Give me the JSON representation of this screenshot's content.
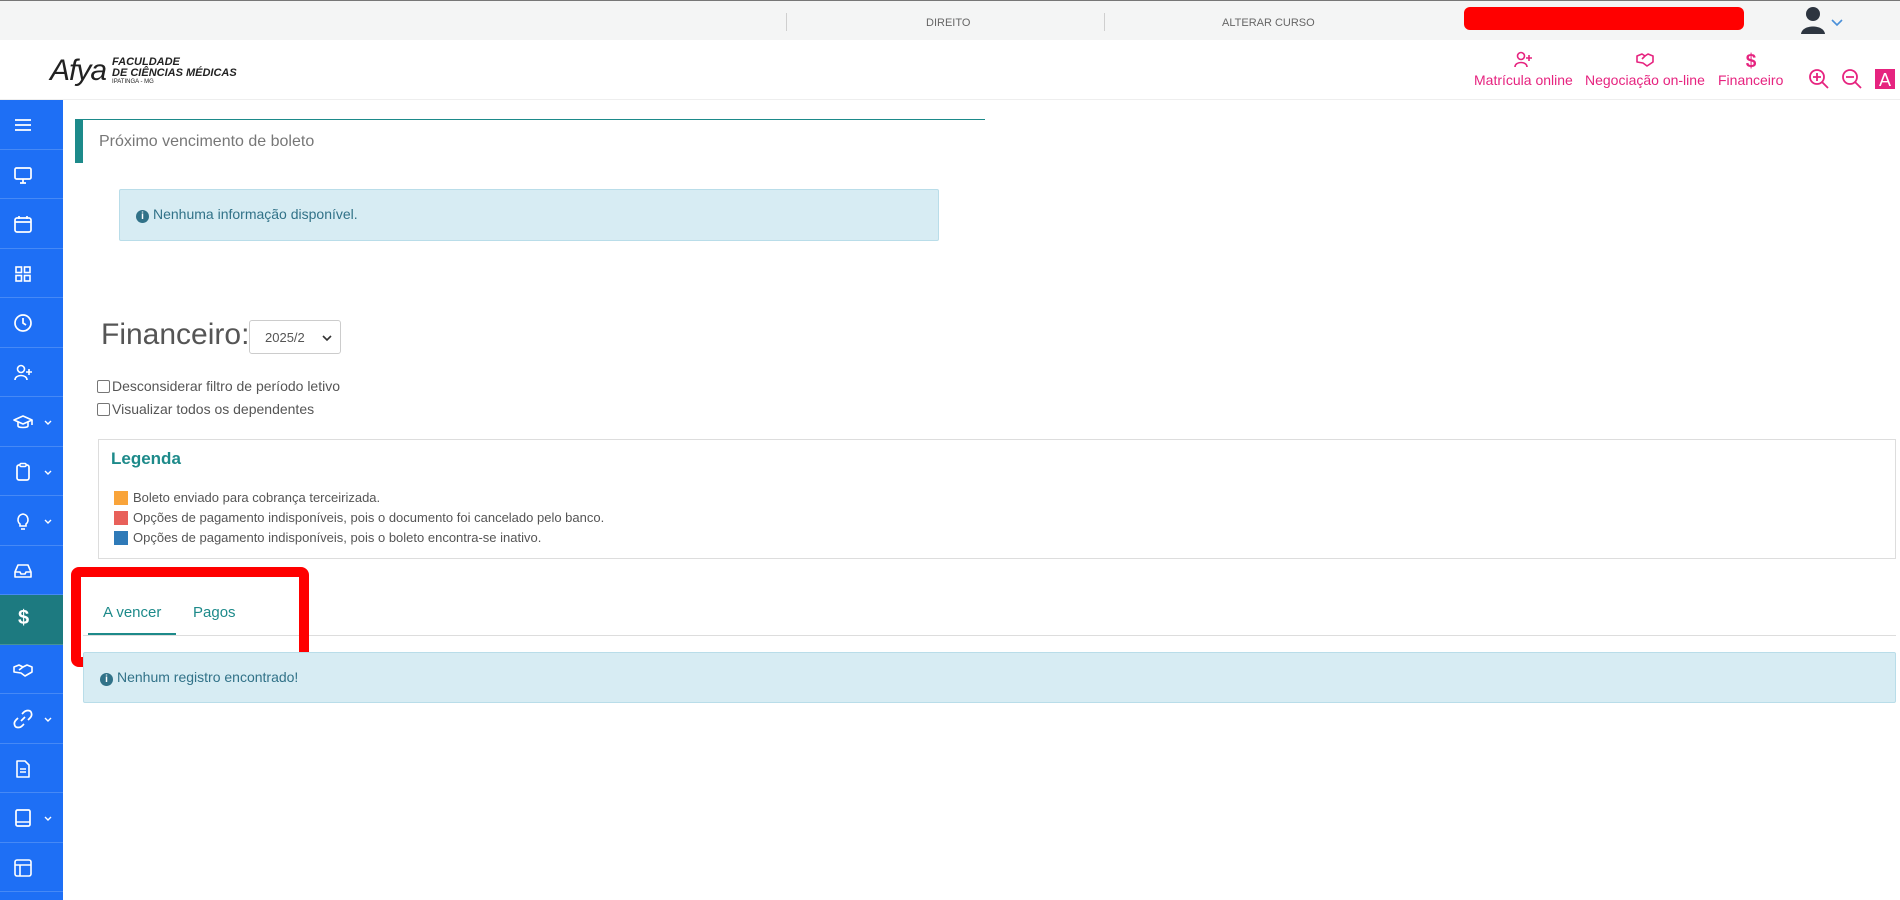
{
  "topbar": {
    "course": "DIREITO",
    "change_course": "ALTERAR CURSO"
  },
  "header": {
    "logo_word": "Afya",
    "logo_line1": "FACULDADE",
    "logo_line2": "DE CIÊNCIAS MÉDICAS",
    "logo_line3": "IPATINGA - MG",
    "nav": [
      {
        "label": "Matrícula online",
        "icon": "user-plus-icon"
      },
      {
        "label": "Negociação on-line",
        "icon": "handshake-icon"
      },
      {
        "label": "Financeiro",
        "icon": "dollar-icon"
      }
    ],
    "accent_color": "#e6237f"
  },
  "sidebar": {
    "color": "#1e6ff5",
    "active_color": "#1d7a80",
    "items": [
      {
        "icon": "menu-icon"
      },
      {
        "icon": "monitor-icon"
      },
      {
        "icon": "calendar-icon"
      },
      {
        "icon": "grid-icon"
      },
      {
        "icon": "clock-icon"
      },
      {
        "icon": "user-plus-icon"
      },
      {
        "icon": "graduation-cap-icon",
        "has_submenu": true
      },
      {
        "icon": "clipboard-icon",
        "has_submenu": true
      },
      {
        "icon": "lightbulb-icon",
        "has_submenu": true
      },
      {
        "icon": "inbox-icon"
      },
      {
        "icon": "dollar-icon",
        "active": true
      },
      {
        "icon": "handshake-icon"
      },
      {
        "icon": "link-icon",
        "has_submenu": true
      },
      {
        "icon": "document-icon"
      },
      {
        "icon": "book-icon",
        "has_submenu": true
      },
      {
        "icon": "layout-icon"
      }
    ]
  },
  "boleto": {
    "title": "Próximo vencimento de boleto",
    "info": "Nenhuma informação disponível."
  },
  "financeiro": {
    "title": "Financeiro:",
    "period_selected": "2025/2",
    "checkbox_1": "Desconsiderar filtro de período letivo",
    "checkbox_2": "Visualizar todos os dependentes"
  },
  "legend": {
    "title": "Legenda",
    "items": [
      {
        "color": "#f9a43a",
        "text": "Boleto enviado para cobrança terceirizada."
      },
      {
        "color": "#e8605a",
        "text": "Opções de pagamento indisponíveis, pois o documento foi cancelado pelo banco."
      },
      {
        "color": "#2f7ab8",
        "text": "Opções de pagamento indisponíveis, pois o boleto encontra-se inativo."
      }
    ]
  },
  "tabs": [
    {
      "label": "A vencer",
      "active": true
    },
    {
      "label": "Pagos",
      "active": false
    }
  ],
  "results": {
    "message": "Nenhum registro encontrado!"
  }
}
